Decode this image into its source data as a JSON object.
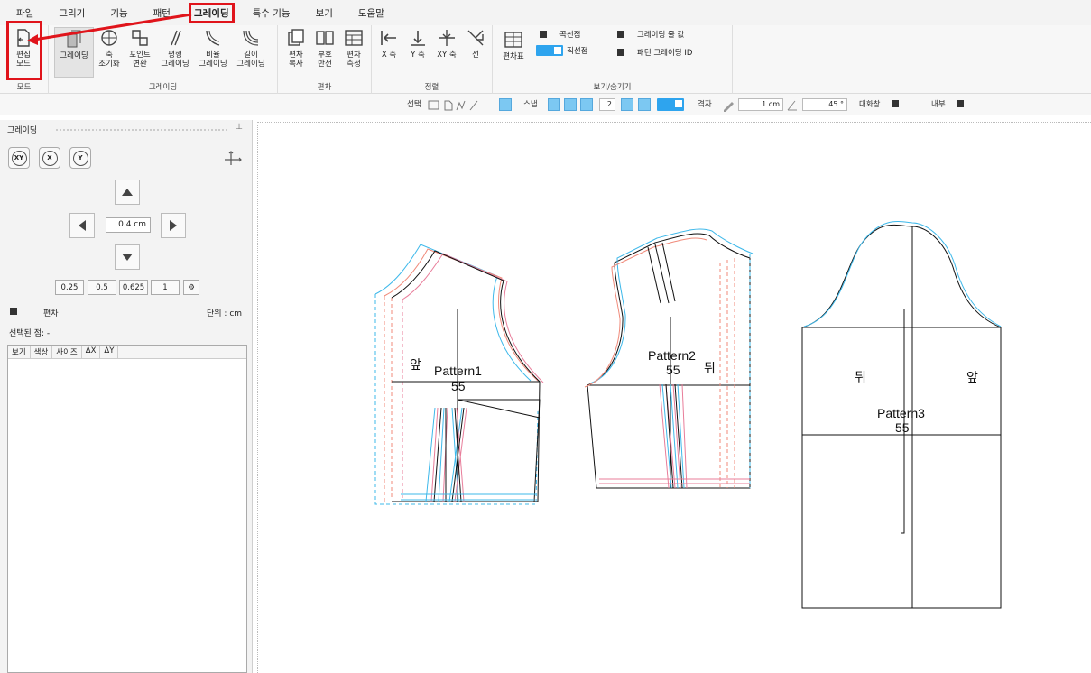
{
  "menu": [
    "파일",
    "그리기",
    "기능",
    "패턴",
    "그레이딩",
    "특수 기능",
    "보기",
    "도움말"
  ],
  "ribbon": {
    "mode": {
      "btn1": "편집",
      "btn2": "모드",
      "group": "모드"
    },
    "grading": {
      "group": "그레이딩",
      "b1": "그레이딩",
      "b2a": "축",
      "b2b": "조기화",
      "b3a": "포인트",
      "b3b": "변환",
      "b4a": "평행",
      "b4b": "그레이딩",
      "b5a": "비율",
      "b5b": "그레이딩",
      "b6a": "길이",
      "b6b": "그레이딩"
    },
    "deviation": {
      "group": "편차",
      "b1a": "편차",
      "b1b": "복사",
      "b2a": "부호",
      "b2b": "반전",
      "b3a": "편차",
      "b3b": "측정"
    },
    "align": {
      "group": "정렬",
      "x": "X 축",
      "y": "Y 축",
      "xy": "XY 축",
      "line": "선"
    },
    "view": {
      "group": "보기/숨기기",
      "table": "편차표",
      "curve": "곡선점",
      "straight": "직선점",
      "grade_val": "그레이딩 줄 값",
      "pattern_id": "패턴 그레이딩 ID"
    }
  },
  "subtoolbar": {
    "select": "선택",
    "snap": "스냅",
    "snap_val": "2",
    "grid": "격자",
    "grid_val": "1 cm",
    "angle_val": "45 °",
    "dialog": "대화창",
    "inner": "내부"
  },
  "panel": {
    "title": "그레이딩",
    "step": "0.4 cm",
    "presets": [
      "0.25",
      "0.5",
      "0.625",
      "1"
    ],
    "dev_label": "편차",
    "unit": "단위 : cm",
    "selected": "선택된 점: -",
    "columns": [
      "보기",
      "색상",
      "사이즈",
      "ΔX",
      "ΔY"
    ]
  },
  "canvas": {
    "p1_name": "Pattern1",
    "p1_size": "55",
    "p1_front": "앞",
    "p2_name": "Pattern2",
    "p2_size": "55",
    "p2_back": "뒤",
    "p3_name": "Pattern3",
    "p3_size": "55",
    "p3_back": "뒤",
    "p3_front": "앞"
  },
  "colors": {
    "accent": "#e0141b",
    "toggle": "#2ea4ee",
    "grade_blue": "#3db8ea",
    "grade_red": "#f08a7a",
    "grade_pink": "#e87d9a"
  }
}
